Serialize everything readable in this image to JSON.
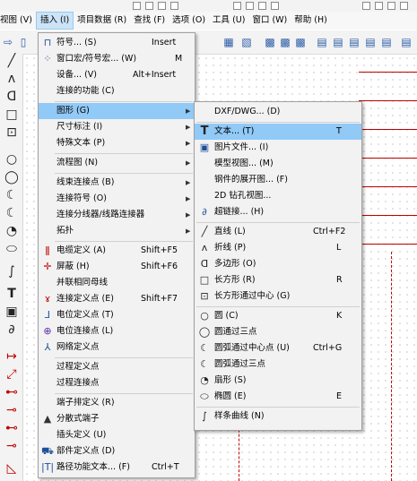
{
  "menubar": {
    "items": [
      "视图 (V)",
      "插入 (I)",
      "项目数据 (R)",
      "查找 (F)",
      "选项 (O)",
      "工具 (U)",
      "窗口 (W)",
      "帮助 (H)"
    ]
  },
  "insert_menu": {
    "items": [
      {
        "label": "符号... (S)",
        "shortcut": "Insert"
      },
      {
        "label": "窗口宏/符号宏... (W)",
        "shortcut": "M"
      },
      {
        "label": "设备... (V)",
        "shortcut": "Alt+Insert"
      },
      {
        "label": "连接的功能 (C)",
        "shortcut": ""
      },
      {
        "label": "图形 (G)",
        "shortcut": ""
      },
      {
        "label": "尺寸标注 (I)",
        "shortcut": ""
      },
      {
        "label": "特殊文本 (P)",
        "shortcut": ""
      },
      {
        "label": "流程图 (N)",
        "shortcut": ""
      },
      {
        "label": "线束连接点 (B)",
        "shortcut": ""
      },
      {
        "label": "连接符号 (O)",
        "shortcut": ""
      },
      {
        "label": "连接分线器/线路连接器",
        "shortcut": ""
      },
      {
        "label": "拓扑",
        "shortcut": ""
      },
      {
        "label": "电缆定义 (A)",
        "shortcut": "Shift+F5"
      },
      {
        "label": "屏蔽 (H)",
        "shortcut": "Shift+F6"
      },
      {
        "label": "并联相同母线",
        "shortcut": ""
      },
      {
        "label": "连接定义点 (E)",
        "shortcut": "Shift+F7"
      },
      {
        "label": "电位定义点 (T)",
        "shortcut": ""
      },
      {
        "label": "电位连接点 (L)",
        "shortcut": ""
      },
      {
        "label": "网络定义点",
        "shortcut": ""
      },
      {
        "label": "过程定义点",
        "shortcut": ""
      },
      {
        "label": "过程连接点",
        "shortcut": ""
      },
      {
        "label": "端子排定义 (R)",
        "shortcut": ""
      },
      {
        "label": "分散式端子",
        "shortcut": ""
      },
      {
        "label": "插头定义 (U)",
        "shortcut": ""
      },
      {
        "label": "部件定义点 (D)",
        "shortcut": ""
      },
      {
        "label": "路径功能文本... (F)",
        "shortcut": "Ctrl+T"
      }
    ]
  },
  "graphics_menu": {
    "items": [
      {
        "label": "DXF/DWG... (D)",
        "shortcut": ""
      },
      {
        "label": "文本... (T)",
        "shortcut": "T"
      },
      {
        "label": "图片文件... (I)",
        "shortcut": ""
      },
      {
        "label": "模型视图... (M)",
        "shortcut": ""
      },
      {
        "label": "钢件的展开图... (F)",
        "shortcut": ""
      },
      {
        "label": "2D 钻孔视图...",
        "shortcut": ""
      },
      {
        "label": "超链接... (H)",
        "shortcut": ""
      },
      {
        "label": "直线 (L)",
        "shortcut": "Ctrl+F2"
      },
      {
        "label": "折线 (P)",
        "shortcut": "L"
      },
      {
        "label": "多边形 (O)",
        "shortcut": ""
      },
      {
        "label": "长方形 (R)",
        "shortcut": "R"
      },
      {
        "label": "长方形通过中心 (G)",
        "shortcut": ""
      },
      {
        "label": "圆 (C)",
        "shortcut": "K"
      },
      {
        "label": "圆通过三点",
        "shortcut": ""
      },
      {
        "label": "圆弧通过中心点 (U)",
        "shortcut": "Ctrl+G"
      },
      {
        "label": "圆弧通过三点",
        "shortcut": ""
      },
      {
        "label": "扇形 (S)",
        "shortcut": ""
      },
      {
        "label": "椭圆 (E)",
        "shortcut": "E"
      },
      {
        "label": "样条曲线 (N)",
        "shortcut": ""
      }
    ]
  }
}
